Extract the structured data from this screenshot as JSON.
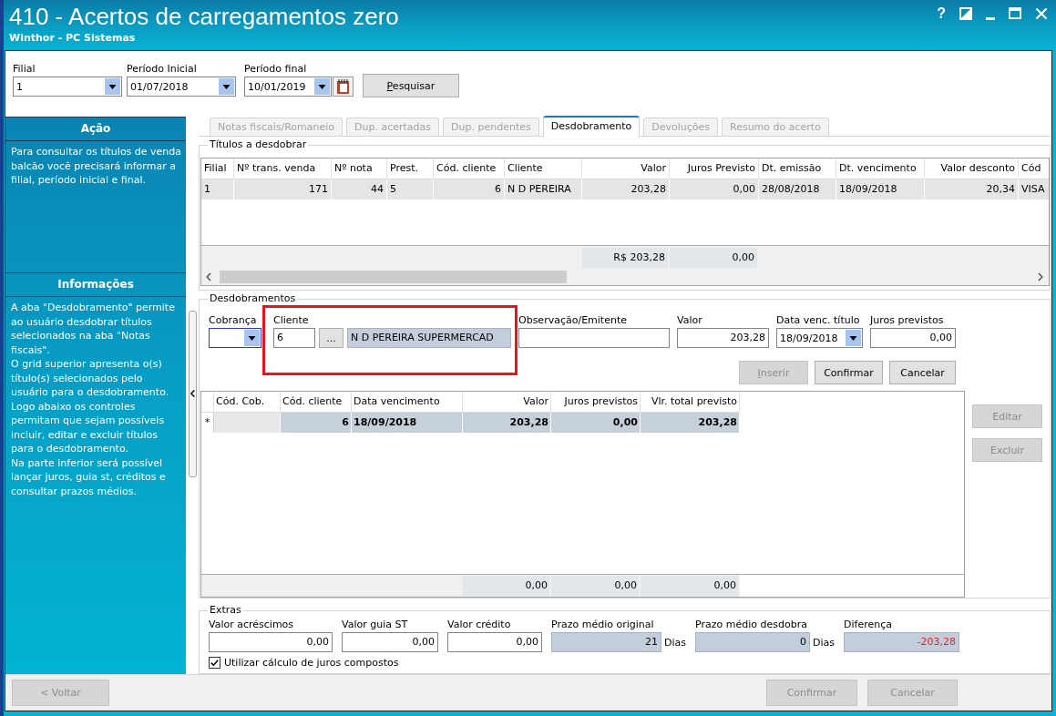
{
  "window": {
    "title": "410 - Acertos de carregamentos zero",
    "subtitle": "Winthor - PC Sistemas",
    "controls": [
      {
        "kind": "help",
        "label": "?"
      },
      {
        "kind": "contrast"
      },
      {
        "kind": "minimize"
      },
      {
        "kind": "maximize"
      },
      {
        "kind": "close"
      }
    ]
  },
  "filters": {
    "fields": [
      {
        "label": "Filial",
        "value": "1",
        "kind": "combo"
      },
      {
        "label": "Período Inicial",
        "value": "01/07/2018",
        "kind": "combo"
      },
      {
        "label": "Período final",
        "value": "10/01/2019",
        "kind": "combo_calendar"
      }
    ],
    "search_button": {
      "label": "Pesquisar",
      "mnemonic": true
    }
  },
  "sidebar": {
    "sections": [
      {
        "title": "Ação",
        "paragraphs": [
          "Para consultar os títulos de venda balcão você precisará informar a filial, período inicial e final."
        ]
      },
      {
        "title": "Informações",
        "paragraphs": [
          "A aba \"Desdobramento\" permite ao usuário desdobrar títulos selecionados na aba \"Notas fiscais\".",
          "O grid superior apresenta o(s) título(s) selecionados pelo usuário para o desdobramento.",
          "Logo abaixo os controles permitam que sejam possíveis incluir, editar e excluir títulos para o desdobramento.",
          "Na parte inferior será possível lançar juros, guia st, créditos e consultar prazos médios."
        ]
      }
    ]
  },
  "tabs": [
    {
      "label": "Notas fiscais/Romaneio",
      "selected": false,
      "disabled": true
    },
    {
      "label": "Dup. acertadas",
      "selected": false,
      "disabled": true
    },
    {
      "label": "Dup. pendentes",
      "selected": false,
      "disabled": true
    },
    {
      "label": "Desdobramento",
      "selected": true,
      "disabled": false
    },
    {
      "label": "Devoluções",
      "selected": false,
      "disabled": true
    },
    {
      "label": "Resumo do acerto",
      "selected": false,
      "disabled": true
    }
  ],
  "titulos": {
    "title": "Títulos a desdobrar",
    "columns": [
      {
        "label": "Filial",
        "kind": "text"
      },
      {
        "label": "Nº trans. venda",
        "kind": "integer"
      },
      {
        "label": "Nº nota",
        "kind": "integer"
      },
      {
        "label": "Prest.",
        "kind": "text"
      },
      {
        "label": "Cód. cliente",
        "kind": "integer"
      },
      {
        "label": "Cliente",
        "kind": "text"
      },
      {
        "label": "Valor",
        "kind": "money"
      },
      {
        "label": "Juros Previsto",
        "kind": "money"
      },
      {
        "label": "Dt. emissão",
        "kind": "text"
      },
      {
        "label": "Dt. vencimento",
        "kind": "text"
      },
      {
        "label": "Valor desconto",
        "kind": "money"
      },
      {
        "label": "Cód",
        "kind": "text"
      }
    ],
    "rows": [
      {
        "kind": "data",
        "selected": true,
        "cells": [
          "1",
          "171",
          "44",
          "5",
          "6",
          "N D PEREIRA",
          "203,28",
          "0,00",
          "28/08/2018",
          "18/09/2018",
          "20,34",
          "VISA"
        ]
      },
      {
        "kind": "totals",
        "cells": [
          null,
          null,
          null,
          null,
          null,
          null,
          "R$ 203,28",
          "0,00",
          null,
          null,
          null,
          null
        ]
      }
    ]
  },
  "desdobramentos": {
    "title": "Desdobramentos",
    "fields": [
      {
        "kind": "combo",
        "label": "Cobrança",
        "focused": true,
        "highlighted": false
      },
      {
        "kind": "lookup",
        "label": "Cliente",
        "value": "6",
        "button": "...",
        "name": "N D PEREIRA SUPERMERCAD",
        "focused": false,
        "highlighted": true
      },
      {
        "kind": "text",
        "label": "Observação/Emitente",
        "focused": false,
        "highlighted": false
      },
      {
        "kind": "number",
        "label": "Valor",
        "value": "203,28",
        "focused": false,
        "highlighted": false
      },
      {
        "kind": "combo",
        "label": "Data venc. título",
        "value": "18/09/2018",
        "focused": false,
        "highlighted": false
      },
      {
        "kind": "number",
        "label": "Juros previstos",
        "value": "0,00",
        "focused": false,
        "highlighted": false
      }
    ],
    "buttons": [
      {
        "label": "Inserir",
        "disabled": true,
        "mnemonic": true
      },
      {
        "label": "Confirmar",
        "disabled": false,
        "mnemonic": false
      },
      {
        "label": "Cancelar",
        "disabled": false,
        "mnemonic": false
      }
    ],
    "grid": {
      "columns": [
        {
          "label": "Cód. Cob.",
          "kind": "text"
        },
        {
          "label": "Cód. cliente",
          "kind": "integer"
        },
        {
          "label": "Data vencimento",
          "kind": "text"
        },
        {
          "label": "Valor",
          "kind": "money"
        },
        {
          "label": "Juros previstos",
          "kind": "money"
        },
        {
          "label": "Vlr. total previsto",
          "kind": "money"
        }
      ],
      "rows": [
        {
          "kind": "data",
          "indicator": "*",
          "selected": true,
          "cells": [
            null,
            "6",
            "18/09/2018",
            "203,28",
            "0,00",
            "203,28"
          ]
        },
        {
          "kind": "totals",
          "cells": [
            null,
            null,
            null,
            "0,00",
            "0,00",
            "0,00"
          ]
        }
      ]
    },
    "side_buttons": [
      {
        "label": "Editar",
        "disabled": true
      },
      {
        "label": "Excluir",
        "disabled": true
      }
    ]
  },
  "extras": {
    "title": "Extras",
    "fields": [
      {
        "label": "Valor acréscimos",
        "value": "0,00",
        "readonly": false,
        "negative": false
      },
      {
        "label": "Valor guia ST",
        "value": "0,00",
        "readonly": false,
        "negative": false
      },
      {
        "label": "Valor crédito",
        "value": "0,00",
        "readonly": false,
        "negative": false
      },
      {
        "label": "Prazo médio original",
        "value": "21",
        "unit": "Dias",
        "readonly": true,
        "negative": false
      },
      {
        "label": "Prazo médio desdobra",
        "value": "0",
        "unit": "Dias",
        "readonly": true,
        "negative": false
      },
      {
        "label": "Diferença",
        "value": "-203,28",
        "readonly": true,
        "negative": true
      }
    ],
    "checkbox": {
      "label": "Utilizar cálculo de juros compostos",
      "checked": true
    }
  },
  "footer": {
    "back_button": {
      "label": "< Voltar",
      "disabled": true
    },
    "buttons": [
      {
        "label": "Confirmar",
        "disabled": true
      },
      {
        "label": "Cancelar",
        "disabled": true
      }
    ]
  }
}
